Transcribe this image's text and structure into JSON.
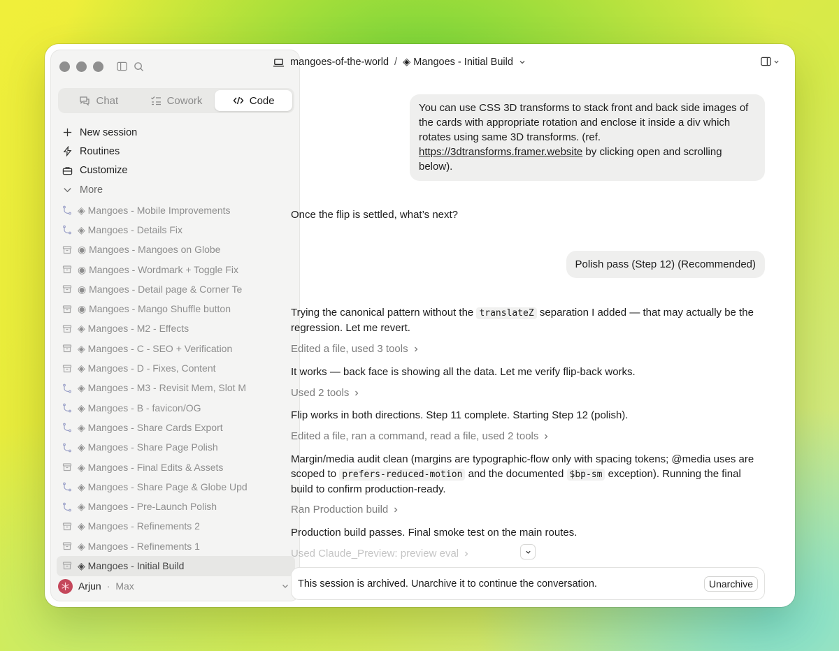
{
  "sidebar": {
    "tabs": [
      {
        "label": "Chat",
        "icon": "chat-icon"
      },
      {
        "label": "Cowork",
        "icon": "checklist-icon"
      },
      {
        "label": "Code",
        "icon": "code-icon",
        "active": true
      }
    ],
    "nav": [
      {
        "label": "New session",
        "icon": "plus-icon"
      },
      {
        "label": "Routines",
        "icon": "lightning-icon"
      },
      {
        "label": "Customize",
        "icon": "briefcase-icon"
      },
      {
        "label": "More",
        "icon": "chevron-down-icon"
      }
    ],
    "sessions": [
      {
        "label": "◈ Mangoes - Mobile Improvements",
        "icon": "branch-icon"
      },
      {
        "label": "◈ Mangoes - Details Fix",
        "icon": "branch-icon"
      },
      {
        "label": "◉ Mangoes - Mangoes on Globe",
        "icon": "archive-icon"
      },
      {
        "label": "◉ Mangoes - Wordmark + Toggle Fix",
        "icon": "archive-icon"
      },
      {
        "label": "◉ Mangoes - Detail page & Corner Te",
        "icon": "archive-icon"
      },
      {
        "label": "◉ Mangoes - Mango Shuffle button",
        "icon": "archive-icon"
      },
      {
        "label": "◈ Mangoes - M2 - Effects",
        "icon": "archive-icon"
      },
      {
        "label": "◈ Mangoes - C - SEO + Verification",
        "icon": "archive-icon"
      },
      {
        "label": "◈ Mangoes - D - Fixes, Content",
        "icon": "archive-icon"
      },
      {
        "label": "◈ Mangoes - M3 - Revisit Mem, Slot M",
        "icon": "branch-icon"
      },
      {
        "label": "◈ Mangoes - B - favicon/OG",
        "icon": "branch-icon"
      },
      {
        "label": "◈ Mangoes - Share Cards Export",
        "icon": "branch-icon"
      },
      {
        "label": "◈ Mangoes - Share Page Polish",
        "icon": "branch-icon"
      },
      {
        "label": "◈ Mangoes - Final Edits & Assets",
        "icon": "archive-icon"
      },
      {
        "label": "◈ Mangoes - Share Page & Globe Upd",
        "icon": "branch-icon"
      },
      {
        "label": "◈ Mangoes - Pre-Launch Polish",
        "icon": "branch-icon"
      },
      {
        "label": "◈ Mangoes - Refinements 2",
        "icon": "archive-icon"
      },
      {
        "label": "◈ Mangoes - Refinements 1",
        "icon": "archive-icon"
      },
      {
        "label": "◈ Mangoes - Initial Build",
        "icon": "archive-icon",
        "active": true
      }
    ],
    "user": {
      "name": "Arjun",
      "separator": "·",
      "plan": "Max"
    }
  },
  "topbar": {
    "project": "mangoes-of-the-world",
    "separator": "/",
    "session": "◈ Mangoes - Initial Build"
  },
  "conversation": {
    "user_msg1_pre": "You can use CSS 3D transforms to stack front and back side images of the cards with appropriate rotation and enclose it inside a div which rotates using same 3D transforms. (ref. ",
    "user_msg1_link": "https://3dtransforms.framer.website",
    "user_msg1_post": " by clicking open and scrolling below).",
    "question": "Once the flip is settled, what’s next?",
    "user_msg2": "Polish pass (Step 12) (Recommended)",
    "p1_pre": "Trying the canonical pattern without the ",
    "p1_code": "translateZ",
    "p1_post": " separation I added — that may actually be the regression. Let me revert.",
    "tool1": "Edited a file, used 3 tools",
    "p2": "It works — back face is showing all the data. Let me verify flip-back works.",
    "tool2": "Used 2 tools",
    "p3": "Flip works in both directions. Step 11 complete. Starting Step 12 (polish).",
    "tool3": "Edited a file, ran a command, read a file, used 2 tools",
    "p4_pre": "Margin/media audit clean (margins are typographic-flow only with spacing tokens; @media uses are scoped to ",
    "p4_code1": "prefers-reduced-motion",
    "p4_mid": " and the documented ",
    "p4_code2": "$bp-sm",
    "p4_post": " exception). Running the final build to confirm production-ready.",
    "tool4": "Ran Production build",
    "p5": "Production build passes. Final smoke test on the main routes.",
    "tool5": "Used Claude_Preview: preview eval"
  },
  "archived": {
    "message": "This session is archived. Unarchive it to continue the conversation.",
    "button": "Unarchive"
  }
}
